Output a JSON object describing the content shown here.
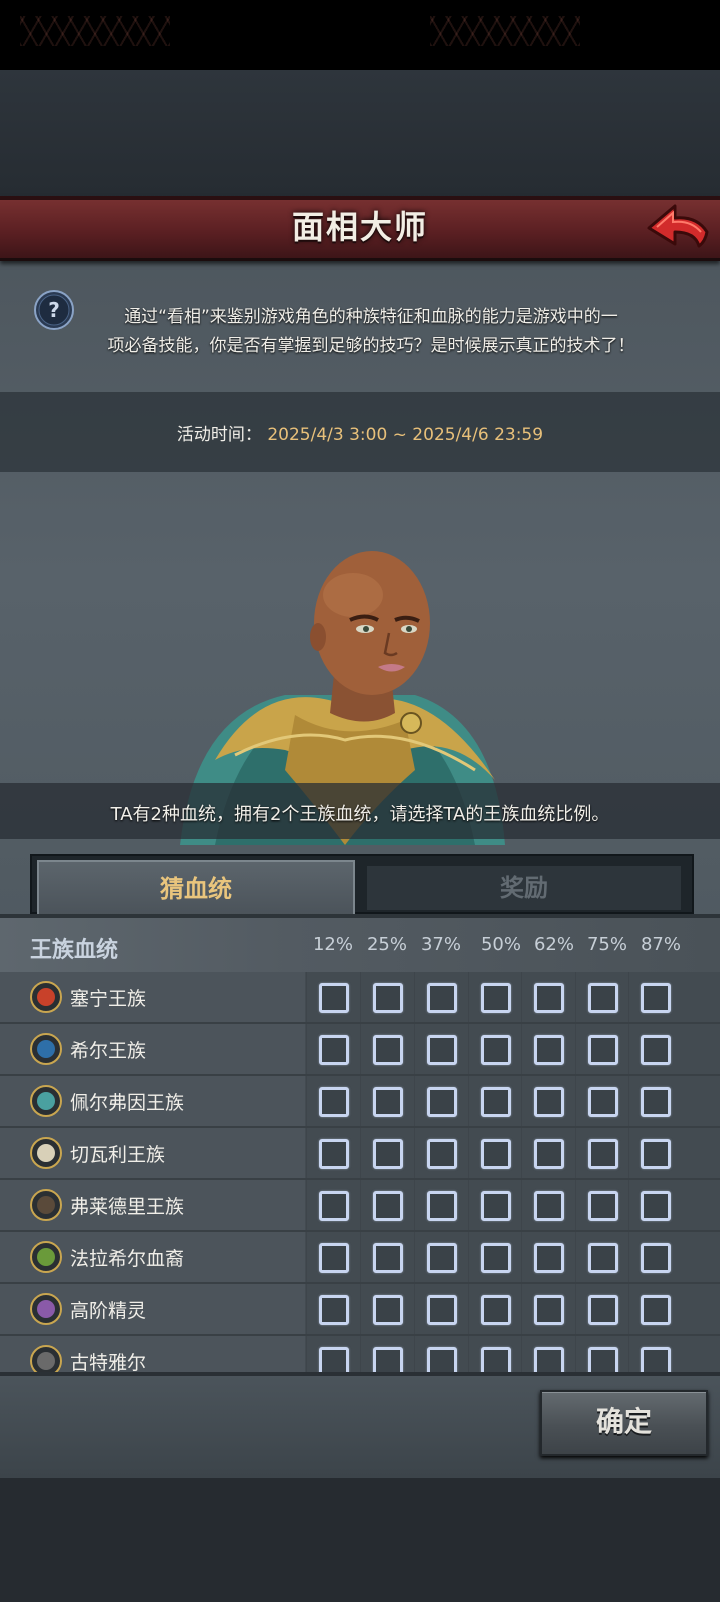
{
  "header": {
    "title": "面相大师",
    "back_icon": "back-arrow-icon",
    "accent": "#d22b2b"
  },
  "intro": {
    "help_icon": "question-mark-icon",
    "line1": "通过“看相”来鉴别游戏角色的种族特征和血脉的能力是游戏中的一",
    "line2": "项必备技能，你是否有掌握到足够的技巧？是时候展示真正的技术了！"
  },
  "event_time": {
    "label": "活动时间：",
    "value": "2025/4/3 3:00 ~ 2025/4/6 23:59"
  },
  "question": "TA有2种血统，拥有2个王族血统，请选择TA的王族血统比例。",
  "tabs": [
    {
      "label": "猜血统",
      "active": true
    },
    {
      "label": "奖励",
      "active": false
    }
  ],
  "table": {
    "header_label": "王族血统",
    "percentages": [
      "12%",
      "25%",
      "37%",
      "50%",
      "62%",
      "75%",
      "87%"
    ],
    "rows": [
      {
        "label": "塞宁王族",
        "icon": "sun-emblem-icon",
        "icon_color": "#c8412a"
      },
      {
        "label": "希尔王族",
        "icon": "wolf-emblem-icon",
        "icon_color": "#2e6fa8"
      },
      {
        "label": "佩尔弗因王族",
        "icon": "wave-emblem-icon",
        "icon_color": "#4aa0a0"
      },
      {
        "label": "切瓦利王族",
        "icon": "scales-emblem-icon",
        "icon_color": "#d8d0b8"
      },
      {
        "label": "弗莱德里王族",
        "icon": "beast-emblem-icon",
        "icon_color": "#5a4a3a"
      },
      {
        "label": "法拉希尔血裔",
        "icon": "tree-emblem-icon",
        "icon_color": "#6a9a3a"
      },
      {
        "label": "高阶精灵",
        "icon": "eye-emblem-icon",
        "icon_color": "#8a5aa8"
      },
      {
        "label": "古特雅尔",
        "icon": "hammer-emblem-icon",
        "icon_color": "#6a6a6a"
      }
    ]
  },
  "confirm_label": "确定"
}
